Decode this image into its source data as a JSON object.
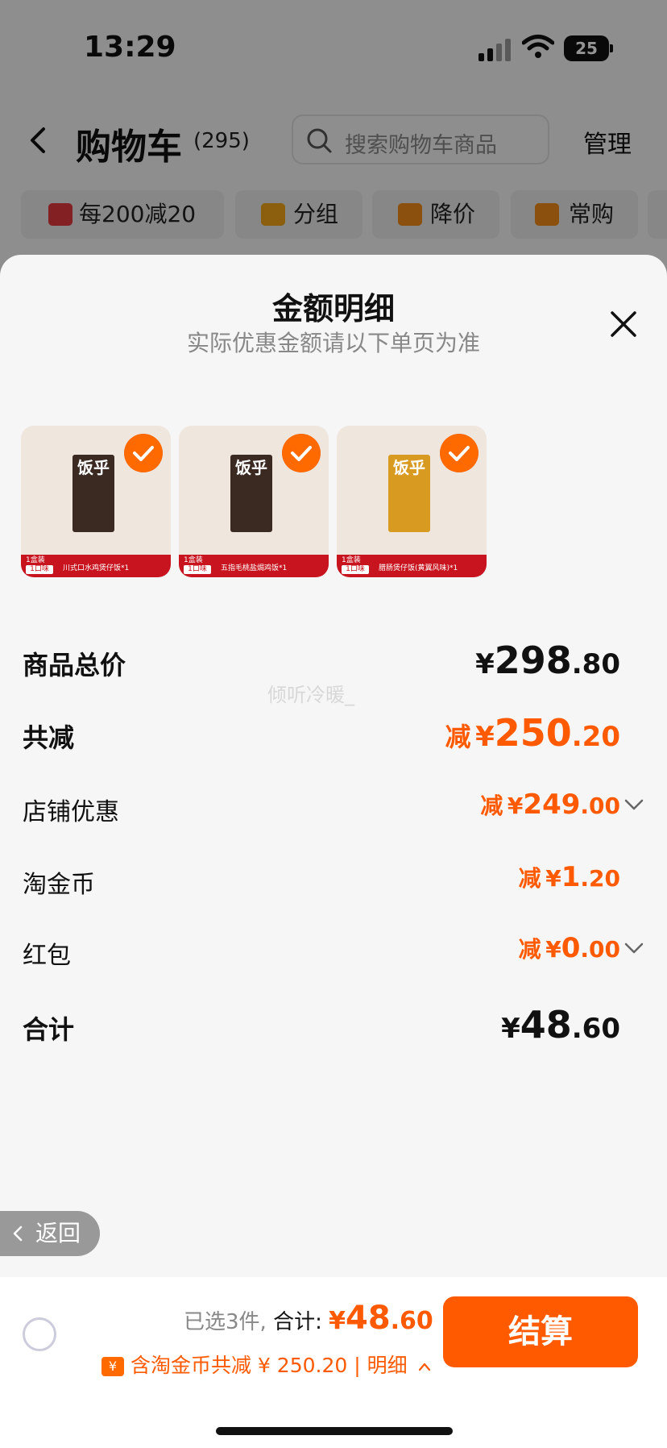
{
  "status_bar": {
    "time": "13:29",
    "battery": "25"
  },
  "header": {
    "title": "购物车",
    "count": "(295)",
    "search_placeholder": "搜索购物车商品",
    "manage": "管理"
  },
  "filters": [
    {
      "label": "每200减20",
      "icon": "shop-icon",
      "color": "#e0383e"
    },
    {
      "label": "分组",
      "icon": "folder-icon",
      "color": "#f0a418"
    },
    {
      "label": "降价",
      "icon": "price-down-icon",
      "color": "#f08a18"
    },
    {
      "label": "常购",
      "icon": "cart-icon",
      "color": "#f08a18"
    }
  ],
  "sheet": {
    "title": "金额明细",
    "subtitle": "实际优惠金额请以下单页为准",
    "products": [
      {
        "box_title": "饭乎",
        "tag_top": "1盒装",
        "tag_bottom": "1口味",
        "strip_text": "川式口水鸡煲仔饭*1"
      },
      {
        "box_title": "饭乎",
        "tag_top": "1盒装",
        "tag_bottom": "1口味",
        "strip_text": "五指毛桃盐焗鸡饭*1"
      },
      {
        "box_title": "饭乎",
        "tag_top": "1盒装",
        "tag_bottom": "1口味",
        "strip_text": "腊肠煲仔饭(黄翼风味)*1"
      }
    ],
    "rows": {
      "total_price": {
        "label": "商品总价",
        "currency": "¥",
        "int": "298",
        "dec": ".80"
      },
      "total_discount": {
        "label": "共减",
        "prefix": "减",
        "currency": "¥",
        "int": "250",
        "dec": ".20"
      },
      "store_discount": {
        "label": "店铺优惠",
        "prefix": "减",
        "currency": "¥",
        "int": "249",
        "dec": ".00"
      },
      "taojinbi": {
        "label": "淘金币",
        "prefix": "减",
        "currency": "¥",
        "int": "1",
        "dec": ".20"
      },
      "red_packet": {
        "label": "红包",
        "prefix": "减",
        "currency": "¥",
        "int": "0",
        "dec": ".00"
      },
      "sum": {
        "label": "合计",
        "currency": "¥",
        "int": "48",
        "dec": ".60"
      }
    },
    "watermark": "倾听冷暖_",
    "back_label": "返回"
  },
  "bottom_bar": {
    "selected": "已选3件,",
    "total_label": "合计:",
    "currency": "¥",
    "int": "48",
    "dec": ".60",
    "discount_text": "含淘金币共减 ¥ 250.20 | 明细",
    "checkout": "结算"
  },
  "colors": {
    "accent": "#ff5a00",
    "brand_red": "#c8141e"
  }
}
